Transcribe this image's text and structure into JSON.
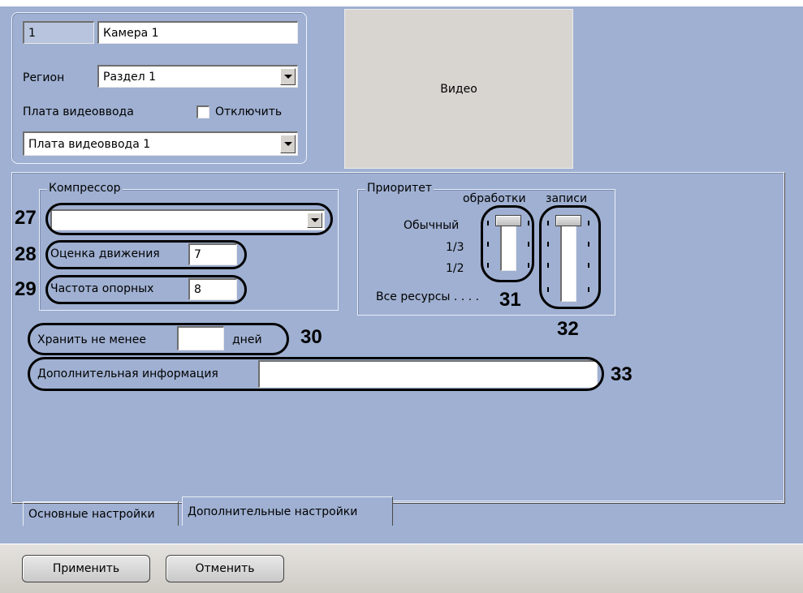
{
  "camera": {
    "id": "1",
    "name": "Камера 1"
  },
  "region": {
    "label": "Регион",
    "value": "Раздел 1"
  },
  "capture_card": {
    "label": "Плата видеоввода",
    "disable_label": "Отключить",
    "value": "Плата видеоввода 1"
  },
  "video": {
    "label": "Видео"
  },
  "compressor": {
    "title": "Компрессор",
    "value": "",
    "motion_label": "Оценка движения",
    "motion_value": "7",
    "keyframe_label": "Частота опорных",
    "keyframe_value": "8"
  },
  "priority": {
    "title": "Приоритет",
    "processing_label": "обработки",
    "recording_label": "записи",
    "levels": [
      "Обычный",
      "1/3",
      "1/2"
    ],
    "all_resources": "Все ресурсы . . . ."
  },
  "storage": {
    "label": "Хранить не менее",
    "value": "",
    "unit": "дней"
  },
  "extra_info": {
    "label": "Дополнительная информация",
    "value": ""
  },
  "callouts": {
    "c27": "27",
    "c28": "28",
    "c29": "29",
    "c30": "30",
    "c31": "31",
    "c32": "32",
    "c33": "33"
  },
  "tabs": [
    {
      "label": "Основные настройки"
    },
    {
      "label": "Дополнительные настройки"
    }
  ],
  "buttons": {
    "apply": "Применить",
    "cancel": "Отменить"
  },
  "colors": {
    "panel": "#9fb0d2",
    "control": "#d6d3ce",
    "footer": "#d4d0c8"
  }
}
